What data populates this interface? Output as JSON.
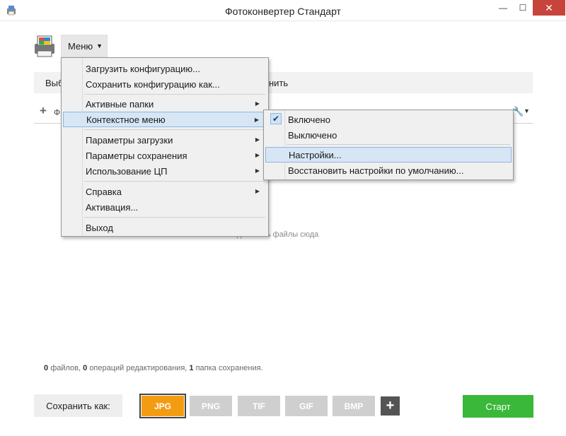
{
  "window": {
    "title": "Фотоконвертер Стандарт",
    "minimize_glyph": "—",
    "maximize_glyph": "☐",
    "close_glyph": "✕"
  },
  "header": {
    "menu_label": "Меню",
    "tab_left_partial": "Выб",
    "tab_right_partial": "нить",
    "files_label_partial": "Ф"
  },
  "main_menu": {
    "items": [
      {
        "label": "Загрузить конфигурацию..."
      },
      {
        "label": "Сохранить конфигурацию как..."
      },
      {
        "label": "Активные папки"
      },
      {
        "label": "Контекстное меню"
      },
      {
        "label": "Параметры загрузки"
      },
      {
        "label": "Параметры сохранения"
      },
      {
        "label": "Использование ЦП"
      },
      {
        "label": "Справка"
      },
      {
        "label": "Активация..."
      },
      {
        "label": "Выход"
      }
    ],
    "highlighted": "Контекстное меню"
  },
  "context_submenu": {
    "items": [
      {
        "label": "Включено",
        "checked": true
      },
      {
        "label": "Выключено",
        "checked": false
      },
      {
        "label": "Настройки..."
      },
      {
        "label": "Восстановить настройки по умолчанию..."
      }
    ],
    "highlighted": "Настройки..."
  },
  "drop_area": {
    "hint": "добавить файлы сюда"
  },
  "status": {
    "files_count": "0",
    "files_text": "файлов,",
    "ops_count": "0",
    "ops_text": "операций редактирования,",
    "folders_count": "1",
    "folders_text": "папка сохранения."
  },
  "bottom": {
    "save_as_label": "Сохранить как:",
    "formats": [
      "JPG",
      "PNG",
      "TIF",
      "GIF",
      "BMP"
    ],
    "active_format": "JPG",
    "add_format_glyph": "+",
    "start_label": "Старт"
  },
  "colors": {
    "active_format": "#f39c12",
    "inactive_format": "#cfcfcf",
    "start_button": "#3ab83a",
    "menu_highlight": "#d6e6f5",
    "close_button": "#c7443d"
  }
}
